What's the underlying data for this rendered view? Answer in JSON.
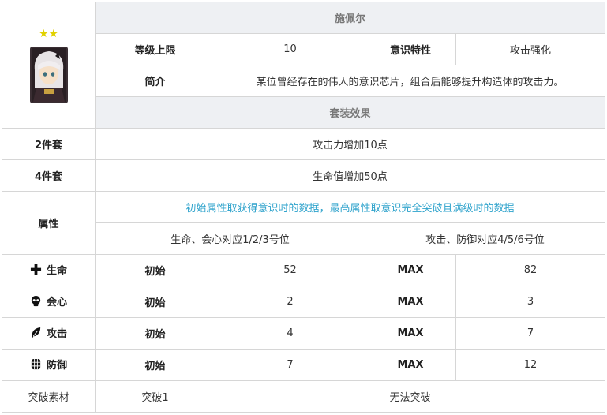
{
  "card": {
    "stars": "★★",
    "name": "施佩尔",
    "level_cap_label": "等级上限",
    "level_cap_value": "10",
    "trait_label": "意识特性",
    "trait_value": "攻击强化",
    "intro_label": "简介",
    "intro_value": "某位曾经存在的伟人的意识芯片，组合后能够提升构造体的攻击力。",
    "set_effect_title": "套装效果",
    "set2_label": "2件套",
    "set2_value": "攻击力增加10点",
    "set4_label": "4件套",
    "set4_value": "生命值增加50点",
    "attr_label": "属性",
    "attr_note": "初始属性取获得意识时的数据，最高属性取意识完全突破且满级时的数据",
    "slots_left": "生命、会心对应1/2/3号位",
    "slots_right": "攻击、防御对应4/5/6号位",
    "initial_label": "初始",
    "max_label": "MAX",
    "stats": [
      {
        "name": "生命",
        "icon": "plus-icon",
        "initial": "52",
        "max": "82"
      },
      {
        "name": "会心",
        "icon": "skull-icon",
        "initial": "2",
        "max": "3"
      },
      {
        "name": "攻击",
        "icon": "feather-icon",
        "initial": "4",
        "max": "7"
      },
      {
        "name": "防御",
        "icon": "shield-block-icon",
        "initial": "7",
        "max": "12"
      }
    ],
    "breakthrough_label": "突破素材",
    "breakthrough_item": "突破1",
    "breakthrough_value": "无法突破"
  },
  "colors": {
    "header_bg": "#eef0f3",
    "note": "#2fa3cc",
    "stars": "#e1d100"
  }
}
